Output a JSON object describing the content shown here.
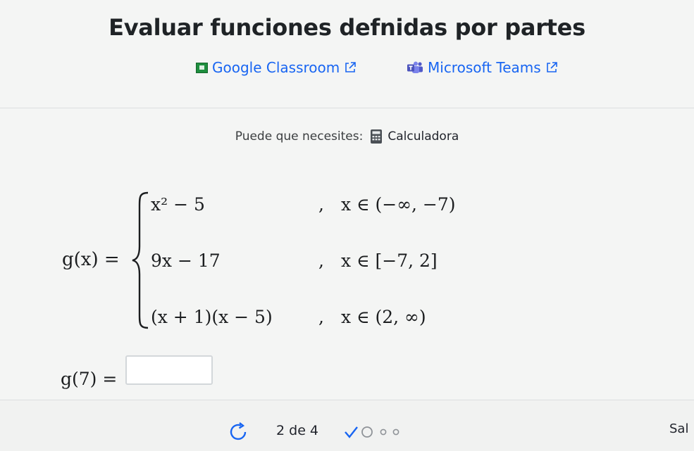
{
  "page": {
    "title": "Evaluar funciones defnidas por partes"
  },
  "share": {
    "google_classroom": "Google Classroom",
    "microsoft_teams": "Microsoft Teams"
  },
  "tools": {
    "prompt": "Puede que necesites:",
    "calculator": "Calculadora"
  },
  "problem": {
    "function_lhs": "g(x) =",
    "pieces": [
      {
        "expr": "x² − 5",
        "comma": ",",
        "domain": "x ∈ (−∞, −7)"
      },
      {
        "expr": "9x − 17",
        "comma": ",",
        "domain": "x ∈ [−7, 2]"
      },
      {
        "expr": "(x + 1)(x − 5)",
        "comma": ",",
        "domain": "x ∈ (2, ∞)"
      }
    ],
    "question": "g(7) =",
    "answer": ""
  },
  "footer": {
    "progress": "2 de 4",
    "skip": "Sal"
  },
  "colors": {
    "link": "#1865f2",
    "check": "#1865f2",
    "dot": "#8f9398"
  }
}
